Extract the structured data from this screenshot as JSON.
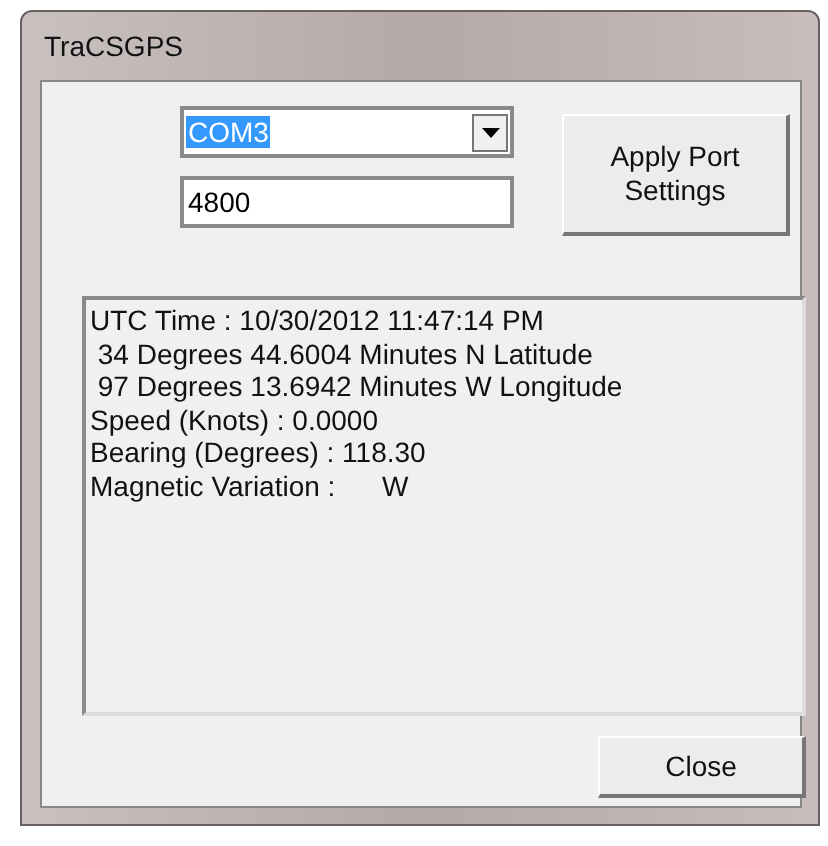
{
  "window": {
    "title": "TraCSGPS"
  },
  "port": {
    "value": "COM3",
    "selected": true
  },
  "baud": {
    "value": "4800"
  },
  "apply_button": {
    "label": "Apply Port\nSettings"
  },
  "output": {
    "lines": [
      "UTC Time : 10/30/2012 11:47:14 PM",
      " 34 Degrees 44.6004 Minutes N Latitude",
      " 97 Degrees 13.6942 Minutes W Longitude",
      "Speed (Knots) : 0.0000",
      "Bearing (Degrees) : 118.30",
      "Magnetic Variation :      W"
    ]
  },
  "close_button": {
    "label": "Close"
  }
}
